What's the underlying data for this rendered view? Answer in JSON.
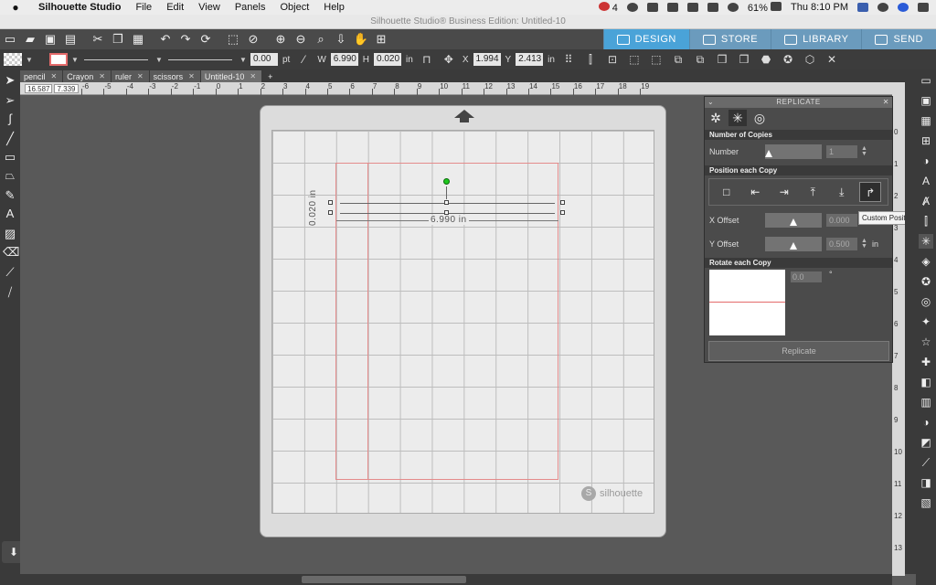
{
  "menubar": {
    "app": "Silhouette Studio",
    "items": [
      "File",
      "Edit",
      "View",
      "Panels",
      "Object",
      "Help"
    ],
    "notif_count": "4",
    "battery": "61%",
    "clock": "Thu 8:10 PM"
  },
  "window": {
    "title": "Silhouette Studio® Business Edition: Untitled-10"
  },
  "nav_tabs": [
    {
      "label": "DESIGN",
      "icon": "grid-icon"
    },
    {
      "label": "STORE",
      "icon": "store-icon"
    },
    {
      "label": "LIBRARY",
      "icon": "library-icon"
    },
    {
      "label": "SEND",
      "icon": "send-icon"
    }
  ],
  "toolbar2": {
    "line_width": "0.00",
    "line_unit": "pt",
    "w_label": "W",
    "w_value": "6.990",
    "h_label": "H",
    "h_value": "0.020",
    "size_unit": "in",
    "x_label": "X",
    "x_value": "1.994",
    "y_label": "Y",
    "y_value": "2.413",
    "pos_unit": "in"
  },
  "doc_tabs": [
    "pencil",
    "Crayon",
    "ruler",
    "scissors",
    "Untitled-10"
  ],
  "coords": {
    "x": "16.587",
    "y": "7.339"
  },
  "ruler": {
    "h": [
      "-6",
      "-5",
      "-4",
      "-3",
      "-2",
      "-1",
      "0",
      "1",
      "2",
      "3",
      "4",
      "5",
      "6",
      "7",
      "8",
      "9",
      "10",
      "11",
      "12",
      "13",
      "14",
      "15",
      "16",
      "17",
      "18",
      "19"
    ],
    "v": [
      "0",
      "1",
      "2",
      "3",
      "4",
      "5",
      "6",
      "7",
      "8",
      "9",
      "10",
      "11",
      "12",
      "13"
    ]
  },
  "canvas": {
    "dim_width": "6.990 in",
    "dim_height": "0.020 in",
    "brand": "silhouette"
  },
  "panel": {
    "title": "REPLICATE",
    "sec_copies": "Number of Copies",
    "number_label": "Number",
    "number_value": "1",
    "sec_position": "Position each Copy",
    "x_offset_label": "X Offset",
    "x_offset_value": "0.000",
    "y_offset_label": "Y Offset",
    "y_offset_value": "0.500",
    "offset_unit": "in",
    "sec_rotate": "Rotate each Copy",
    "rotate_value": "0.0",
    "rotate_unit": "°",
    "replicate_button": "Replicate",
    "tooltip": "Custom Position"
  }
}
